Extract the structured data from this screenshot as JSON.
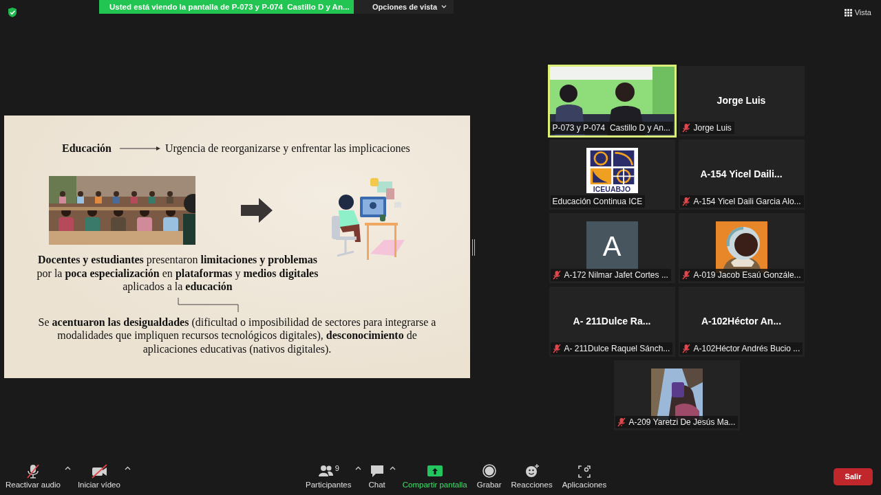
{
  "top_bar": {
    "banner": "Usted está viendo la pantalla de P-073 y P-074  Castillo D y An...",
    "view_options": "Opciones de vista",
    "view_button": "Vista"
  },
  "slide": {
    "heading": "Educación",
    "heading_note": "Urgencia de reorganizarse y enfrentar las implicaciones",
    "paragraph_1": "**Docentes y estudiantes** presentaron **limitaciones y problemas** por la **poca especialización** en **plataformas** y **medios digitales** aplicados a la **educación**",
    "paragraph_2": "Se **acentuaron las desigualdades** (dificultad o imposibilidad de sectores para integrarse a modalidades que impliquen recursos tecnológicos digitales), **desconocimiento** de aplicaciones educativas (nativos digitales)."
  },
  "participants": [
    {
      "kind": "video",
      "name": "P-073 y P-074  Castillo D y An...",
      "muted": false,
      "speaking": true
    },
    {
      "kind": "name",
      "display": "Jorge Luis",
      "name": "Jorge Luis",
      "muted": true,
      "speaking": false
    },
    {
      "kind": "logo",
      "logo_text": "ICEUABJO",
      "name": "Educación Continua ICE",
      "muted": false,
      "speaking": false
    },
    {
      "kind": "name",
      "display": "A-154 Yicel Daili...",
      "name": "A-154 Yicel Daili Garcia Alo...",
      "muted": true,
      "speaking": false
    },
    {
      "kind": "initial",
      "initial": "A",
      "name": "A-172 Nilmar Jafet Cortes ...",
      "muted": true,
      "speaking": false
    },
    {
      "kind": "avatar",
      "name": "A-019 Jacob Esaú Gonzále...",
      "muted": true,
      "speaking": false
    },
    {
      "kind": "name",
      "display": "A- 211Dulce Ra...",
      "name": "A- 211Dulce Raquel Sánch...",
      "muted": true,
      "speaking": false
    },
    {
      "kind": "name",
      "display": "A-102Héctor An...",
      "name": "A-102Héctor Andrés Bucio ...",
      "muted": true,
      "speaking": false
    },
    {
      "name": "A-209 Yaretzi De Jesús Ma...",
      "muted": true,
      "speaking": false
    }
  ],
  "toolbar": {
    "left": [
      {
        "kind": "audio",
        "label": "Reactivar audio",
        "off": true,
        "has_menu": true
      },
      {
        "kind": "video",
        "label": "Iniciar vídeo",
        "off": true,
        "has_menu": true
      }
    ],
    "center": [
      {
        "kind": "participants",
        "label": "Participantes",
        "count": "9",
        "has_menu": true
      },
      {
        "kind": "chat",
        "label": "Chat",
        "has_menu": true
      },
      {
        "kind": "share",
        "label": "Compartir pantalla",
        "has_menu": false
      },
      {
        "kind": "record",
        "label": "Grabar",
        "has_menu": false
      },
      {
        "kind": "reactions",
        "label": "Reacciones",
        "has_menu": false
      },
      {
        "kind": "apps",
        "label": "Aplicaciones",
        "has_menu": false
      }
    ],
    "leave": "Salir"
  }
}
